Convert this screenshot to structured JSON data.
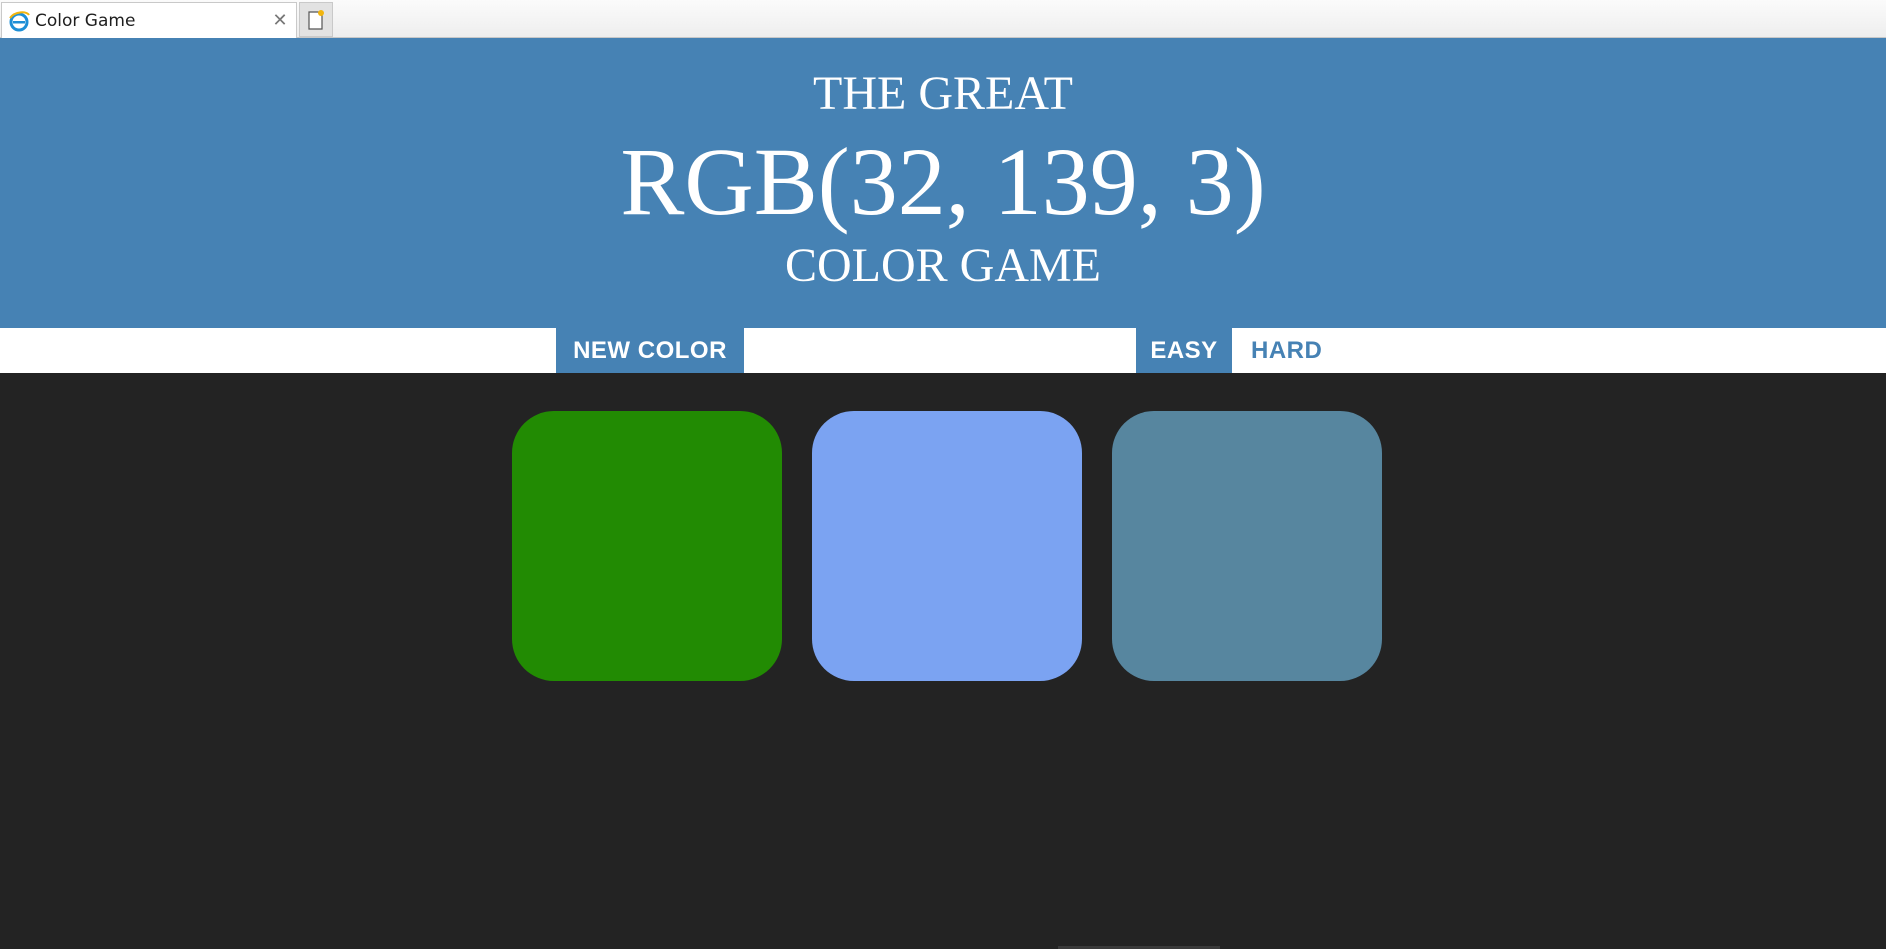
{
  "browser": {
    "tab_title": "Color Game",
    "tab_close_glyph": "✕",
    "tab_icon": "ie-icon",
    "new_tab_icon": "new-tab-icon"
  },
  "header": {
    "line1": "THE GREAT",
    "target_rgb": "RGB(32, 139, 3)",
    "line3": "COLOR GAME",
    "background": "#4682b4",
    "text_color": "#ffffff"
  },
  "controls": {
    "new_color_label": "NEW COLOR",
    "message": "",
    "easy_label": "EASY",
    "hard_label": "HARD",
    "selected_mode": "EASY",
    "accent": "#4682b4"
  },
  "squares": [
    {
      "color": "#228b03"
    },
    {
      "color": "#7ba3f2"
    },
    {
      "color": "#57869f"
    }
  ],
  "page_background": "#232323"
}
